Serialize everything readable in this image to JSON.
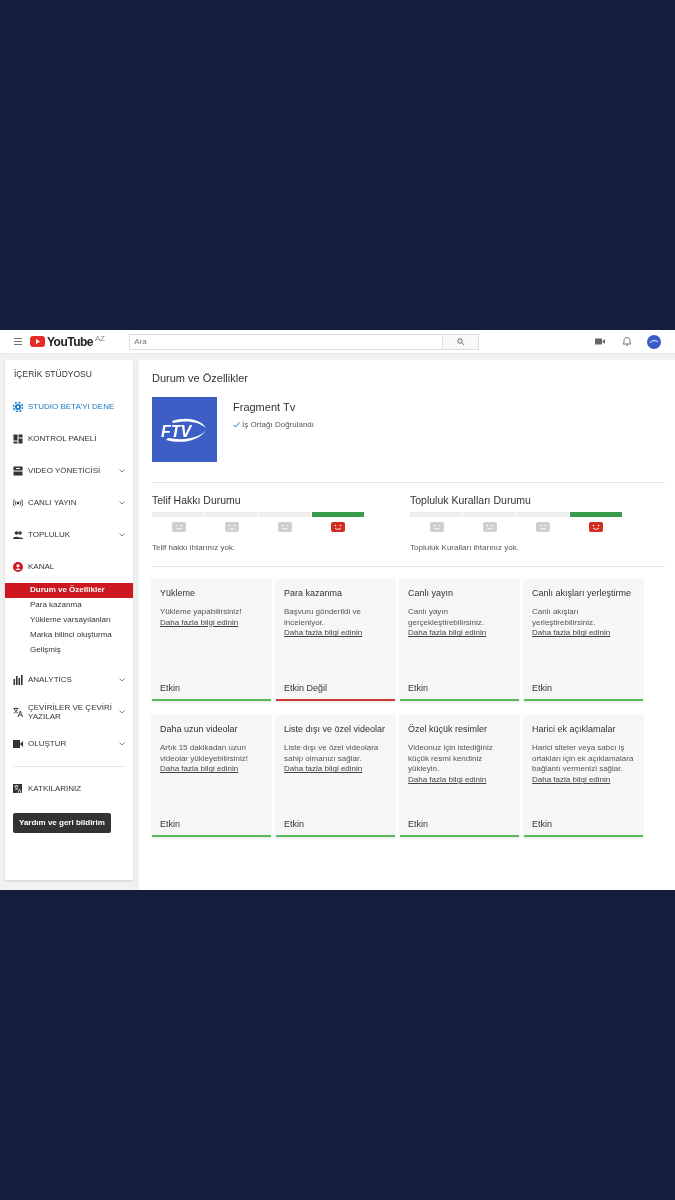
{
  "topbar": {
    "logo_text": "YouTube",
    "region": "AZ",
    "search": {
      "placeholder": "Ara"
    }
  },
  "sidebar": {
    "heading": "İÇERİK STÜDYOSU",
    "items": [
      {
        "label": "STUDIO BETA'YI DENE",
        "kind": "promo",
        "expandable": false,
        "selected": false
      },
      {
        "label": "KONTROL PANELİ",
        "kind": "section",
        "expandable": false,
        "selected": false
      },
      {
        "label": "VIDEO YÖNETİCİSİ",
        "kind": "section",
        "expandable": true,
        "selected": false
      },
      {
        "label": "CANLI YAYIN",
        "kind": "section",
        "expandable": true,
        "selected": false
      },
      {
        "label": "TOPLULUK",
        "kind": "section",
        "expandable": true,
        "selected": false
      },
      {
        "label": "KANAL",
        "kind": "section",
        "expandable": false,
        "selected": true,
        "children": [
          {
            "label": "Durum ve Özellikler",
            "selected": true
          },
          {
            "label": "Para kazanma",
            "selected": false
          },
          {
            "label": "Yükleme varsayılanları",
            "selected": false
          },
          {
            "label": "Marka bilinci oluşturma",
            "selected": false
          },
          {
            "label": "Gelişmiş",
            "selected": false
          }
        ]
      },
      {
        "label": "ANALYTICS",
        "kind": "section",
        "expandable": true,
        "selected": false
      },
      {
        "label": "ÇEVİRİLER VE ÇEVİRİ YAZILAR",
        "kind": "section",
        "expandable": true,
        "selected": false
      },
      {
        "label": "OLUŞTUR",
        "kind": "section",
        "expandable": true,
        "selected": false
      },
      {
        "label": "KATKILARINIZ",
        "kind": "footer",
        "expandable": false,
        "selected": false
      }
    ],
    "feedback_button": "Yardım ve geri bildirim"
  },
  "page": {
    "title": "Durum ve Özellikler",
    "channel": {
      "logo_text": "FTV",
      "name": "Fragment Tv",
      "verified": "İş Ortağı Doğrulandı"
    },
    "statuses": [
      {
        "title": "Telif Hakkı Durumu",
        "segments": [
          {
            "selected": false
          },
          {
            "selected": false
          },
          {
            "selected": false
          },
          {
            "selected": true
          }
        ],
        "message": "Telif hakkı ihtarınız yok."
      },
      {
        "title": "Topluluk Kuralları Durumu",
        "segments": [
          {
            "selected": false
          },
          {
            "selected": false
          },
          {
            "selected": false
          },
          {
            "selected": true
          }
        ],
        "message": "Topluluk Kuralları ihtarınız yok."
      }
    ],
    "features": [
      {
        "title": "Yükleme",
        "description": "Yükleme yapabilirsiniz!",
        "link": "Daha fazla bilgi edinin",
        "status": "Etkin",
        "enabled": true
      },
      {
        "title": "Para kazanma",
        "description": "Başvuru gönderildi ve inceleniyor.",
        "link": "Daha fazla bilgi edinin",
        "status": "Etkin Değil",
        "enabled": false
      },
      {
        "title": "Canlı yayın",
        "description": "Canlı yayın gerçekleştirebilirsiniz.",
        "link": "Daha fazla bilgi edinin",
        "status": "Etkin",
        "enabled": true
      },
      {
        "title": "Canlı akışları yerleştirme",
        "description": "Canlı akışları yerleştirebilirsiniz.",
        "link": "Daha fazla bilgi edinin",
        "status": "Etkin",
        "enabled": true
      },
      {
        "title": "Daha uzun videolar",
        "description": "Artık 15 dakikadan uzun videolar yükleyebilirsiniz!",
        "link": "Daha fazla bilgi edinin",
        "status": "Etkin",
        "enabled": true
      },
      {
        "title": "Liste dışı ve özel videolar",
        "description": "Liste dışı ve özel videolara sahip olmanızı sağlar.",
        "link": "Daha fazla bilgi edinin",
        "status": "Etkin",
        "enabled": true
      },
      {
        "title": "Özel küçük resimler",
        "description": "Videonuz için istediğiniz küçük resmi kendiniz yükleyin.",
        "link": "Daha fazla bilgi edinin",
        "status": "Etkin",
        "enabled": true
      },
      {
        "title": "Harici ek açıklamalar",
        "description": "Harici siteler veya sabcı iş ortakları için ek açıklamalara bağlantı vermenizi sağlar.",
        "link": "Daha fazla bilgi edinin",
        "status": "Etkin",
        "enabled": true
      }
    ]
  }
}
